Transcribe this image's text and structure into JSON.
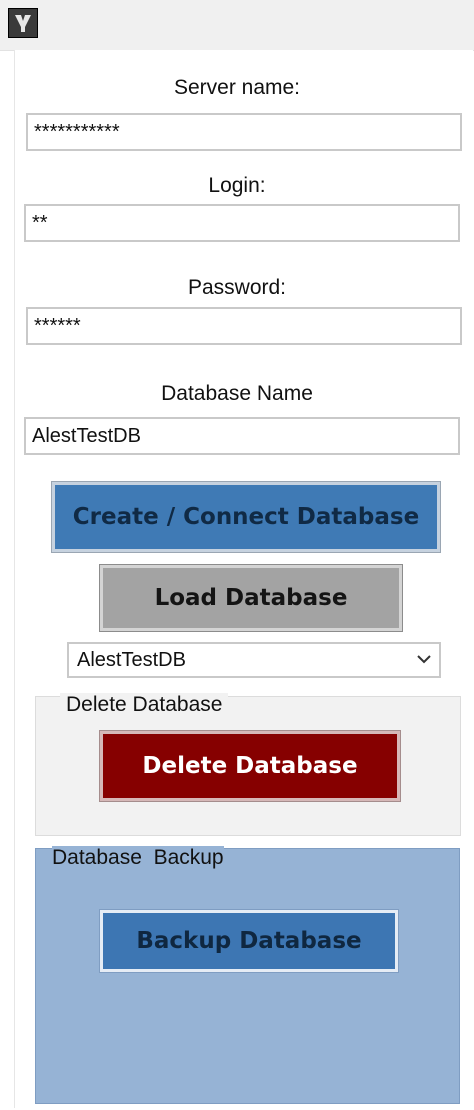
{
  "window": {
    "icon": "app-icon"
  },
  "server": {
    "label": "Server name:",
    "value": "***********"
  },
  "login": {
    "label": "Login:",
    "value": "**"
  },
  "password": {
    "label": "Password:",
    "value": "******"
  },
  "database": {
    "label": "Database Name",
    "value": "AlestTestDB"
  },
  "buttons": {
    "create_connect": "Create / Connect Database",
    "load": "Load Database",
    "delete": "Delete Database",
    "backup": "Backup Database"
  },
  "select": {
    "selected": "AlestTestDB",
    "chevron_icon": "chevron-down-icon"
  },
  "groups": {
    "delete_title": "Delete Database",
    "backup_title": "Database  Backup"
  },
  "colors": {
    "create_button": "#3f7ab5",
    "load_button": "#a3a3a3",
    "delete_button": "#860000",
    "backup_group": "#96b3d5",
    "backup_button": "#3d76b3"
  }
}
